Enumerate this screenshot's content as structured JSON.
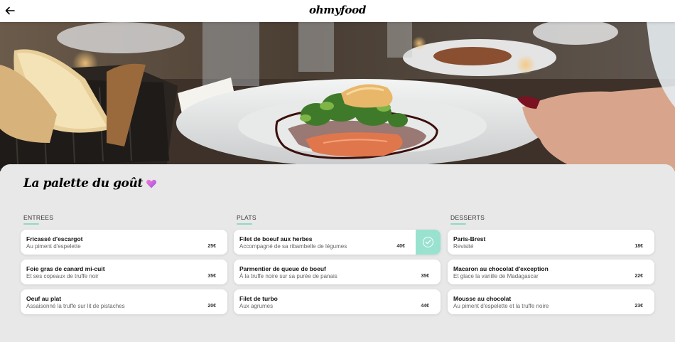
{
  "header": {
    "logo": "ohmyfood",
    "back_icon": "arrow-left-icon"
  },
  "hero": {
    "image_description_icon": "plated-dish-photo"
  },
  "restaurant": {
    "name": "La palette du goût",
    "favorite_icon": "heart-icon"
  },
  "colors": {
    "accent": "#99e2d0",
    "heart_start": "#ff79da",
    "heart_end": "#9356dc"
  },
  "menu": {
    "columns": [
      {
        "title": "ENTREES",
        "dishes": [
          {
            "name": "Fricassé d'escargot",
            "description": "Au piment d'espelette",
            "price": "25€"
          },
          {
            "name": "Foie gras de canard mi-cuit",
            "description": "Et ses copeaux de truffe noir",
            "price": "35€"
          },
          {
            "name": "Oeuf au plat",
            "description": "Assaisonné la truffe sur lit de pistaches",
            "price": "20€"
          }
        ]
      },
      {
        "title": "PLATS",
        "dishes": [
          {
            "name": "Filet de boeuf aux herbes",
            "description": "Accompagné de sa ribambelle de légumes",
            "price": "40€",
            "selected": true
          },
          {
            "name": "Parmentier de queue de boeuf",
            "description": "À la truffe noire sur sa purée de panais",
            "price": "35€"
          },
          {
            "name": "Filet de turbo",
            "description": "Aux agrumes",
            "price": "44€"
          }
        ]
      },
      {
        "title": "DESSERTS",
        "dishes": [
          {
            "name": "Paris-Brest",
            "description": "Revisité",
            "price": "18€"
          },
          {
            "name": "Macaron au chocolat d'exception",
            "description": "Et glace la vanille de Madagascar",
            "price": "22€"
          },
          {
            "name": "Mousse au chocolat",
            "description": "Au piment d'espelette et la truffe noire",
            "price": "23€"
          }
        ]
      }
    ]
  }
}
